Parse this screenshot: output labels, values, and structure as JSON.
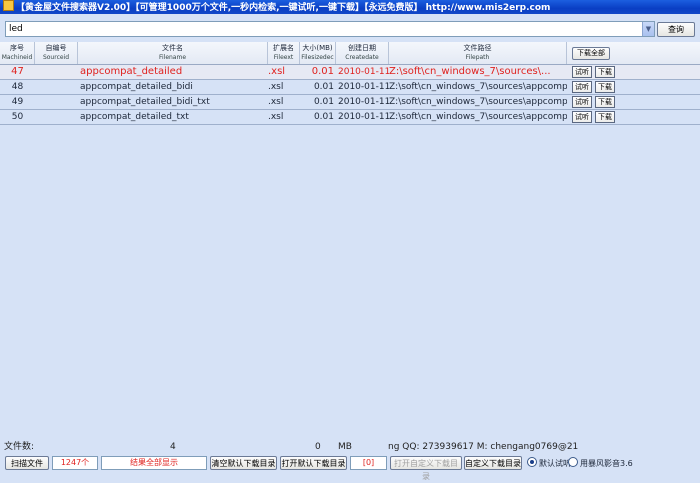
{
  "window": {
    "title": "【黄金屋文件搜索器V2.00】【可管理1000万个文件,一秒内检索,一键试听,一键下载】【永远免费版】 http://www.mis2erp.com"
  },
  "search": {
    "value": "led",
    "search_button": "查询"
  },
  "table": {
    "columns": [
      {
        "cn": "序号",
        "en": "Machineid"
      },
      {
        "cn": "自编号",
        "en": "Sourceid"
      },
      {
        "cn": "文件名",
        "en": "Filename"
      },
      {
        "cn": "扩展名",
        "en": "Fileext"
      },
      {
        "cn": "大小(MB)",
        "en": "Filesizedec"
      },
      {
        "cn": "创建日期",
        "en": "Createdate"
      },
      {
        "cn": "文件路径",
        "en": "Filepath"
      }
    ],
    "download_all_button": "下载全部",
    "rows": [
      {
        "id": "47",
        "sourceid": "",
        "filename": "appcompat_detailed",
        "ext": ".xsl",
        "size": "0.01",
        "date": "2010-01-11",
        "path": "Z:\\soft\\cn_windows_7\\sources\\...",
        "listen": "试听",
        "download": "下载"
      },
      {
        "id": "48",
        "sourceid": "",
        "filename": "appcompat_detailed_bidi",
        "ext": ".xsl",
        "size": "0.01",
        "date": "2010-01-11",
        "path": "Z:\\soft\\cn_windows_7\\sources\\appcomp...",
        "listen": "试听",
        "download": "下载"
      },
      {
        "id": "49",
        "sourceid": "",
        "filename": "appcompat_detailed_bidi_txt",
        "ext": ".xsl",
        "size": "0.01",
        "date": "2010-01-11",
        "path": "Z:\\soft\\cn_windows_7\\sources\\appcomp...",
        "listen": "试听",
        "download": "下载"
      },
      {
        "id": "50",
        "sourceid": "",
        "filename": "appcompat_detailed_txt",
        "ext": ".xsl",
        "size": "0.01",
        "date": "2010-01-11",
        "path": "Z:\\soft\\cn_windows_7\\sources\\appcomp...",
        "listen": "试听",
        "download": "下载"
      }
    ]
  },
  "status": {
    "label": "文件数:",
    "count": "4",
    "size": "0",
    "unit": "MB",
    "contact": "ng  QQ: 273939617  M: chengang0769@21"
  },
  "bottom": {
    "scan_button": "扫描文件",
    "file_count": "1247个",
    "result_text": "结果全部显示",
    "clear_default_dir": "清空默认下载目录",
    "open_default_dir": "打开默认下载目录",
    "bracket_value": "[0]",
    "open_custom_dir": "打开自定义下载目录",
    "custom_dir": "自定义下载目录",
    "radio_default_listen": "默认试听",
    "radio_storm": "用暴风影音3.6"
  }
}
